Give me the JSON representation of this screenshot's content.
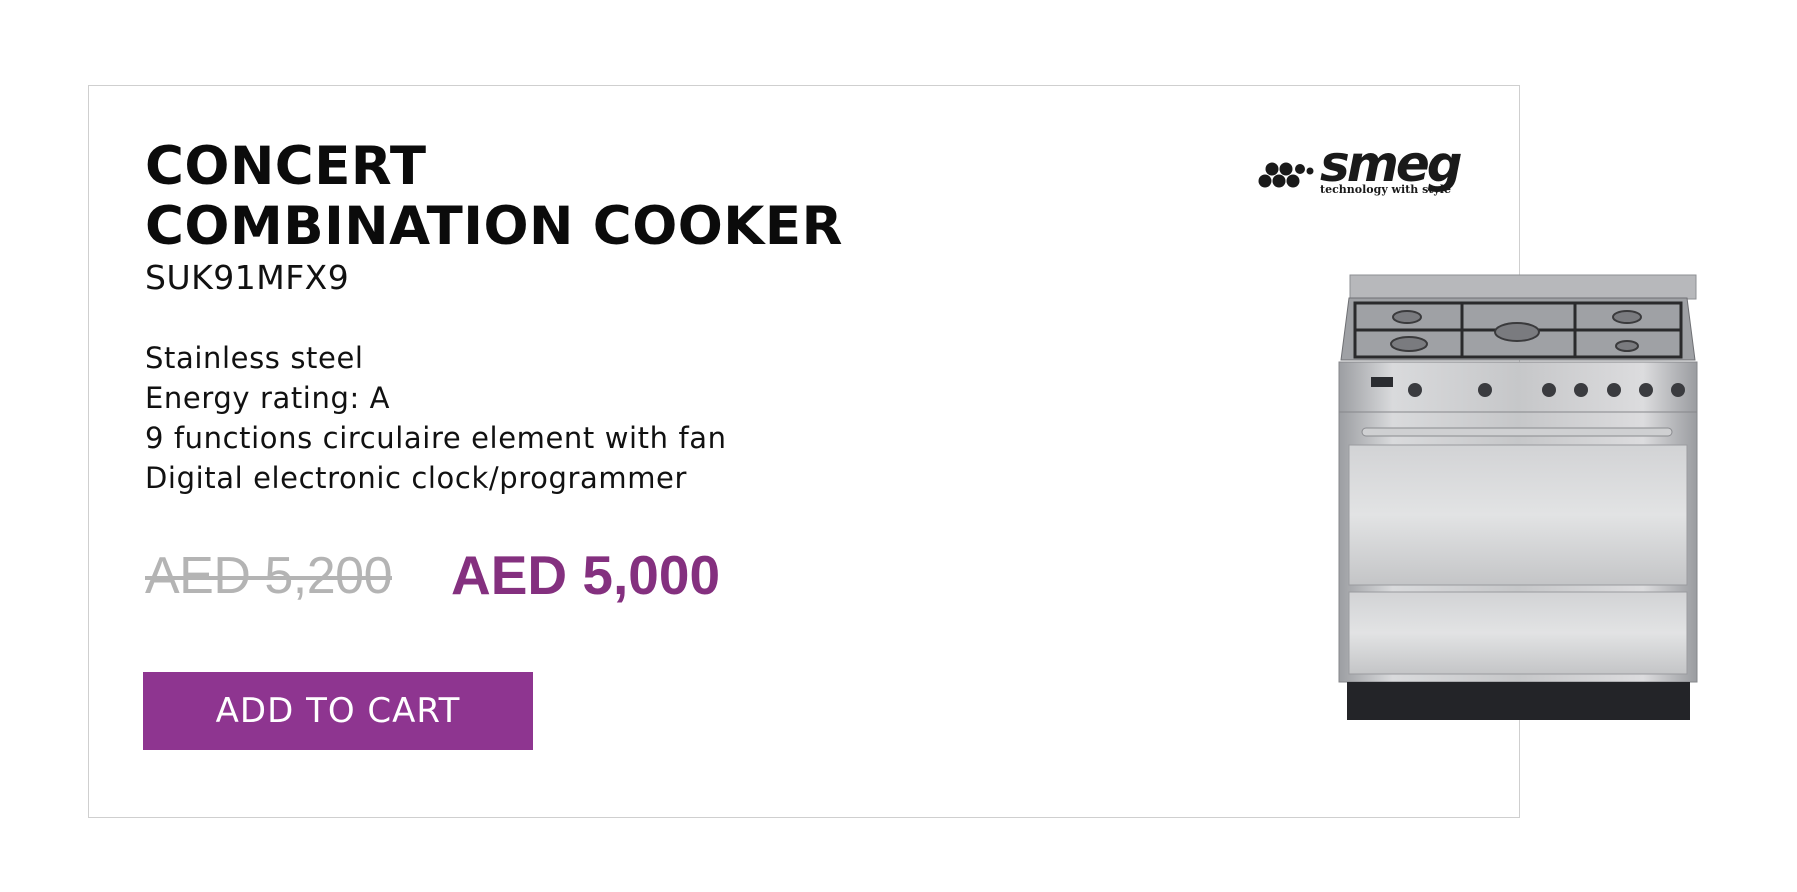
{
  "product": {
    "title_line1": "CONCERT",
    "title_line2": "COMBINATION COOKER",
    "model": "SUK91MFX9",
    "features": [
      "Stainless steel",
      "Energy rating: A",
      "9 functions circulaire element with fan",
      "Digital electronic clock/programmer"
    ],
    "old_price": "AED 5,200",
    "new_price": "AED 5,000",
    "cta_label": "ADD TO CART"
  },
  "brand": {
    "logo_text": "smeg",
    "tagline": "technology with style",
    "icon": "smeg-dots-logo"
  },
  "image": {
    "icon": "range-cooker-image"
  },
  "colors": {
    "accent": "#8e3590",
    "price": "#84307f",
    "old_price": "#b4b4b4",
    "border": "#cfcfcf"
  }
}
